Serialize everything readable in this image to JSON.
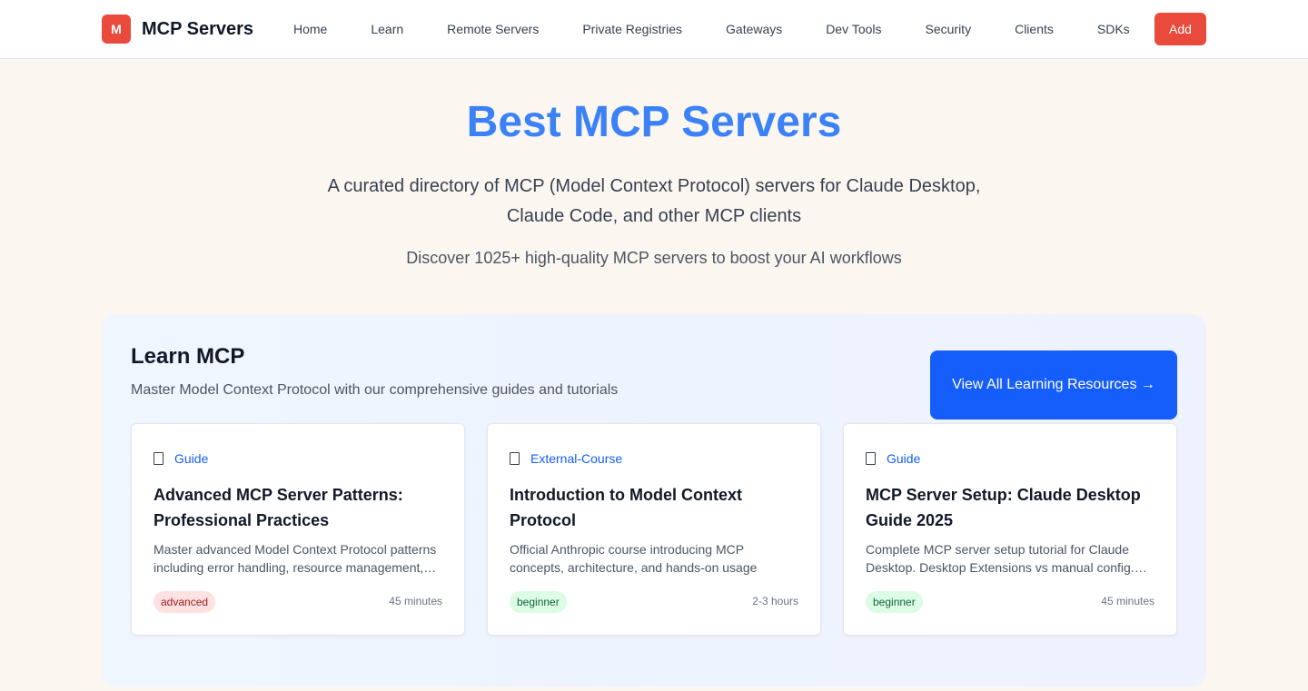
{
  "header": {
    "logo_letter": "M",
    "site_name": "MCP Servers",
    "nav": [
      "Home",
      "Learn",
      "Remote Servers",
      "Private Registries",
      "Gateways",
      "Dev Tools",
      "Security",
      "Clients",
      "SDKs"
    ],
    "add_label": "Add",
    "brand_color": "#ea4a3c"
  },
  "hero": {
    "title": "Best MCP Servers",
    "description": "A curated directory of MCP (Model Context Protocol) servers for Claude Desktop, Claude Code, and other MCP clients",
    "subtitle": "Discover 1025+ high-quality MCP servers to boost your AI workflows",
    "title_color": "#3b82f6"
  },
  "learn": {
    "title": "Learn MCP",
    "subtitle": "Master Model Context Protocol with our comprehensive guides and tutorials",
    "view_all_label": "View All Learning Resources →",
    "cards": [
      {
        "icon": "document-icon",
        "type": "Guide",
        "title": "Advanced MCP Server Patterns: Professional Practices",
        "description": "Master advanced Model Context Protocol patterns including error handling, resource management, security and performance optimization",
        "level": "advanced",
        "duration": "45 minutes"
      },
      {
        "icon": "document-icon",
        "type": "External-Course",
        "title": "Introduction to Model Context Protocol",
        "description": "Official Anthropic course introducing MCP concepts, architecture, and hands-on usage",
        "level": "beginner",
        "duration": "2-3 hours"
      },
      {
        "icon": "document-icon",
        "type": "Guide",
        "title": "MCP Server Setup: Claude Desktop Guide 2025",
        "description": "Complete MCP server setup tutorial for Claude Desktop. Desktop Extensions vs manual config. Troubleshooting and tips included",
        "level": "beginner",
        "duration": "45 minutes"
      }
    ]
  }
}
